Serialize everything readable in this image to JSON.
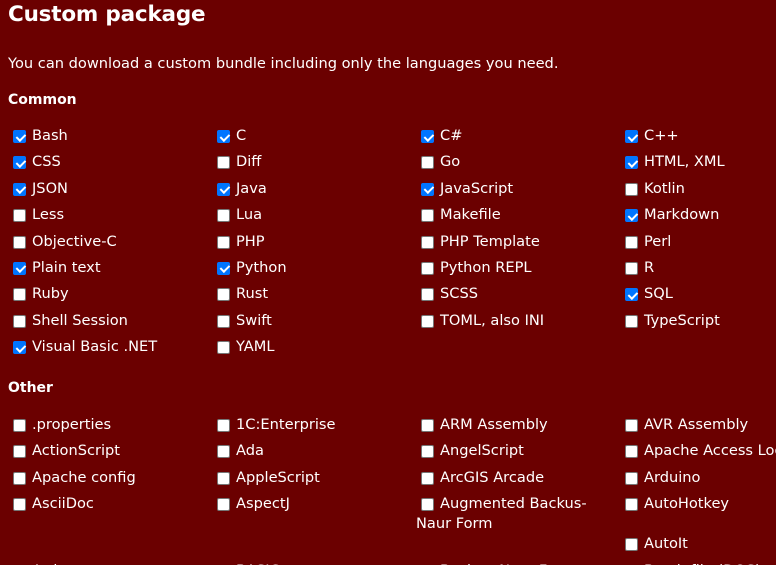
{
  "title": "Custom package",
  "intro": "You can download a custom bundle including only the languages you need.",
  "common": {
    "heading": "Common",
    "items": [
      {
        "label": "Bash",
        "checked": true
      },
      {
        "label": "C",
        "checked": true
      },
      {
        "label": "C#",
        "checked": true
      },
      {
        "label": "C++",
        "checked": true
      },
      {
        "label": "CSS",
        "checked": true
      },
      {
        "label": "Diff",
        "checked": false
      },
      {
        "label": "Go",
        "checked": false
      },
      {
        "label": "HTML, XML",
        "checked": true
      },
      {
        "label": "JSON",
        "checked": true
      },
      {
        "label": "Java",
        "checked": true
      },
      {
        "label": "JavaScript",
        "checked": true
      },
      {
        "label": "Kotlin",
        "checked": false
      },
      {
        "label": "Less",
        "checked": false
      },
      {
        "label": "Lua",
        "checked": false
      },
      {
        "label": "Makefile",
        "checked": false
      },
      {
        "label": "Markdown",
        "checked": true
      },
      {
        "label": "Objective-C",
        "checked": false
      },
      {
        "label": "PHP",
        "checked": false
      },
      {
        "label": "PHP Template",
        "checked": false
      },
      {
        "label": "Perl",
        "checked": false
      },
      {
        "label": "Plain text",
        "checked": true
      },
      {
        "label": "Python",
        "checked": true
      },
      {
        "label": "Python REPL",
        "checked": false
      },
      {
        "label": "R",
        "checked": false
      },
      {
        "label": "Ruby",
        "checked": false
      },
      {
        "label": "Rust",
        "checked": false
      },
      {
        "label": "SCSS",
        "checked": false
      },
      {
        "label": "SQL",
        "checked": true
      },
      {
        "label": "Shell Session",
        "checked": false
      },
      {
        "label": "Swift",
        "checked": false
      },
      {
        "label": "TOML, also INI",
        "checked": false
      },
      {
        "label": "TypeScript",
        "checked": false
      },
      {
        "label": "Visual Basic .NET",
        "checked": true
      },
      {
        "label": "YAML",
        "checked": false
      }
    ]
  },
  "other": {
    "heading": "Other",
    "items": [
      {
        "label": ".properties",
        "checked": false
      },
      {
        "label": "1C:Enterprise",
        "checked": false
      },
      {
        "label": "ARM Assembly",
        "checked": false
      },
      {
        "label": "AVR Assembly",
        "checked": false
      },
      {
        "label": "ActionScript",
        "checked": false
      },
      {
        "label": "Ada",
        "checked": false
      },
      {
        "label": "AngelScript",
        "checked": false
      },
      {
        "label": "Apache Access Log",
        "checked": false
      },
      {
        "label": "Apache config",
        "checked": false
      },
      {
        "label": "AppleScript",
        "checked": false
      },
      {
        "label": "ArcGIS Arcade",
        "checked": false
      },
      {
        "label": "Arduino",
        "checked": false
      },
      {
        "label": "AsciiDoc",
        "checked": false
      },
      {
        "label": "AspectJ",
        "checked": false
      },
      {
        "label": "Augmented Backus-Naur Form",
        "checked": false
      },
      {
        "label": "AutoHotkey",
        "checked": false
      },
      {
        "label": "",
        "checked": null
      },
      {
        "label": "",
        "checked": null
      },
      {
        "label": "",
        "checked": null
      },
      {
        "label": "AutoIt",
        "checked": false
      },
      {
        "label": "Awk",
        "checked": false
      },
      {
        "label": "BASIC",
        "checked": false
      },
      {
        "label": "Backus–Naur Form",
        "checked": false
      },
      {
        "label": "Batch file (DOS)",
        "checked": false
      }
    ]
  },
  "colors": {
    "background": "#6b0000",
    "text": "#ffffff",
    "checkbox_checked": "#0075ff"
  }
}
